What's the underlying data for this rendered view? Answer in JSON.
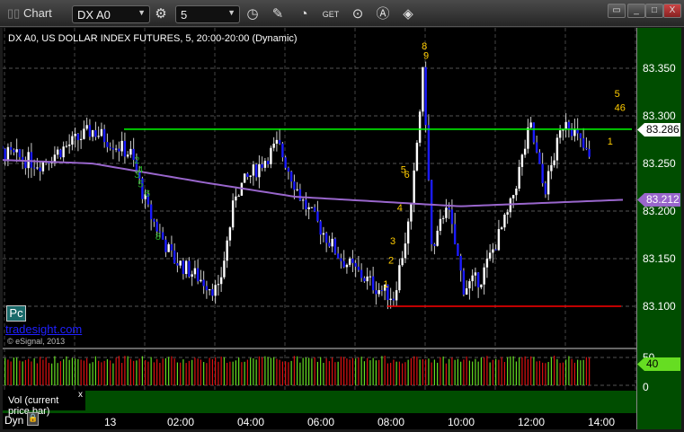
{
  "window": {
    "title": "Chart",
    "symbol": "DX A0",
    "interval": "5"
  },
  "toolbar_icons": [
    "settings-icon",
    "clock-icon",
    "pencil-icon",
    "study-icon",
    "get-icon",
    "play-icon",
    "cursor-icon",
    "link-icon"
  ],
  "header": "DX A0, US DOLLAR INDEX FUTURES, 5, 20:00-20:00 (Dynamic)",
  "logo": {
    "pc": "Pc",
    "site": "tradesight.com",
    "copyright": "© eSignal, 2013"
  },
  "price_axis": [
    "83.350",
    "83.300",
    "83.250",
    "83.200",
    "83.150",
    "83.100"
  ],
  "last_price": "83.286",
  "ma_value": "83.212",
  "volume_axis": [
    "50",
    "0"
  ],
  "volume_last": "40",
  "volume_legend": "Vol (current price bar)",
  "close_x": "x",
  "time_axis": [
    "13",
    "02:00",
    "04:00",
    "06:00",
    "08:00",
    "10:00",
    "12:00",
    "14:00"
  ],
  "footer": {
    "dyn": "Dyn"
  },
  "colors": {
    "up": "#ffffff",
    "down": "#1a1aff",
    "resistance": "#00ff00",
    "support": "#ff0000",
    "ma": "#9966cc",
    "vol_up": "#66dd22",
    "vol_down": "#dd1111"
  },
  "chart_data": {
    "type": "candlestick",
    "ylim": [
      83.07,
      83.37
    ],
    "price_path": [
      [
        0,
        83.27
      ],
      [
        2,
        83.25
      ],
      [
        3.5,
        83.285
      ],
      [
        4.6,
        83.26
      ],
      [
        5.1,
        83.2
      ],
      [
        5.8,
        83.15
      ],
      [
        7.1,
        83.115
      ],
      [
        7.6,
        83.22
      ],
      [
        8.8,
        83.27
      ],
      [
        9.5,
        83.21
      ],
      [
        10.6,
        83.15
      ],
      [
        11.6,
        83.12
      ],
      [
        12.1,
        83.11
      ],
      [
        12.6,
        83.2
      ],
      [
        12.95,
        83.35
      ],
      [
        13.2,
        83.15
      ],
      [
        13.6,
        83.21
      ],
      [
        14.1,
        83.12
      ],
      [
        14.6,
        83.13
      ],
      [
        15.4,
        83.2
      ],
      [
        16,
        83.29
      ],
      [
        16.4,
        83.22
      ],
      [
        17,
        83.3
      ],
      [
        17.9,
        83.24
      ],
      [
        18.75,
        83.286
      ]
    ],
    "ma_path": [
      [
        0,
        83.255
      ],
      [
        3.5,
        83.25
      ],
      [
        6.7,
        83.23
      ],
      [
        9.3,
        83.215
      ],
      [
        14,
        83.205
      ],
      [
        18.75,
        83.212
      ]
    ],
    "resistance": 83.286,
    "support": 83.1,
    "annotations": [
      {
        "t": "8",
        "c": "#ffcc00",
        "h": 12.9,
        "p": 83.37
      },
      {
        "t": "9",
        "c": "#ffcc00",
        "h": 12.95,
        "p": 83.36
      },
      {
        "t": "5",
        "c": "#ffcc00",
        "h": 12.3,
        "p": 83.24
      },
      {
        "t": "6",
        "c": "#ffcc00",
        "h": 12.4,
        "p": 83.235
      },
      {
        "t": "4",
        "c": "#ffcc00",
        "h": 12.2,
        "p": 83.2
      },
      {
        "t": "3",
        "c": "#ffcc00",
        "h": 12.0,
        "p": 83.165
      },
      {
        "t": "2",
        "c": "#ffcc00",
        "h": 11.95,
        "p": 83.145
      },
      {
        "t": "1",
        "c": "#ffcc00",
        "h": 11.8,
        "p": 83.12
      },
      {
        "t": "5",
        "c": "#ffcc00",
        "h": 18.4,
        "p": 83.32
      },
      {
        "t": "46",
        "c": "#ffcc00",
        "h": 18.4,
        "p": 83.305
      },
      {
        "t": "1",
        "c": "#ffcc00",
        "h": 18.2,
        "p": 83.27
      },
      {
        "t": "2",
        "c": "#22aa22",
        "h": 4.7,
        "p": 83.25
      },
      {
        "t": "4",
        "c": "#22aa22",
        "h": 4.8,
        "p": 83.24
      },
      {
        "t": "3",
        "c": "#22aa22",
        "h": 4.7,
        "p": 83.235
      },
      {
        "t": "5",
        "c": "#22aa22",
        "h": 4.8,
        "p": 83.225
      },
      {
        "t": "6",
        "c": "#22aa22",
        "h": 5.0,
        "p": 83.215
      },
      {
        "t": "8",
        "c": "#22aa22",
        "h": 5.3,
        "p": 83.17
      }
    ],
    "volume_range": [
      0,
      55
    ]
  }
}
